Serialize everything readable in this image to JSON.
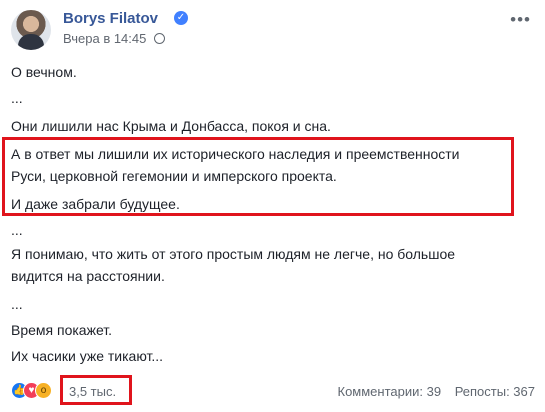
{
  "header": {
    "author": "Borys Filatov",
    "timestamp": "Вчера в 14:45",
    "verified_glyph": "✓",
    "more_glyph": "•••"
  },
  "post": {
    "lines": [
      "О вечном.",
      "...",
      "Они лишили нас Крыма и Донбасса, покоя и сна.",
      "А в ответ мы лишили их исторического наследия и преемственности",
      "Руси, церковной гегемонии и имперского проекта.",
      "И даже забрали будущее.",
      "...",
      "Я понимаю, что жить от этого простым людям не легче, но большое",
      "видится на расстоянии.",
      "...",
      "Время покажет.",
      "Их часики уже тикают..."
    ]
  },
  "footer": {
    "reaction_count": "3,5 тыс.",
    "comments": "Комментарии: 39",
    "shares": "Репосты: 367",
    "reactions": [
      "like",
      "love",
      "wow"
    ]
  },
  "colors": {
    "author": "#385898",
    "highlight": "#e0141c",
    "like": "#1877f2",
    "love": "#f33e58",
    "wow": "#f7b125"
  }
}
